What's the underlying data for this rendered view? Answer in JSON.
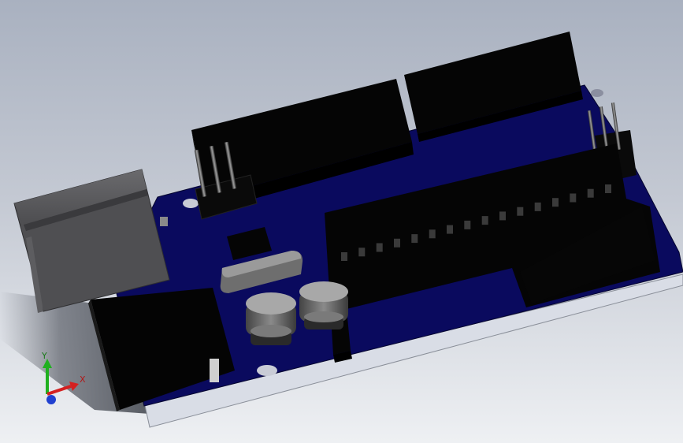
{
  "viewport": {
    "background_top": "#a9b1c0",
    "background_bottom": "#eef0f3"
  },
  "model": {
    "pcb_color": "#0a0a5e",
    "pcb_edge_color": "#d9dde6",
    "component_color": "#050505",
    "usb_color": "#555558",
    "crystal_color": "#7b7b7b"
  },
  "triad": {
    "x_label": "X",
    "y_label": "Y",
    "x_color": "#d42020",
    "y_color": "#20b020",
    "z_color": "#2040d0"
  }
}
